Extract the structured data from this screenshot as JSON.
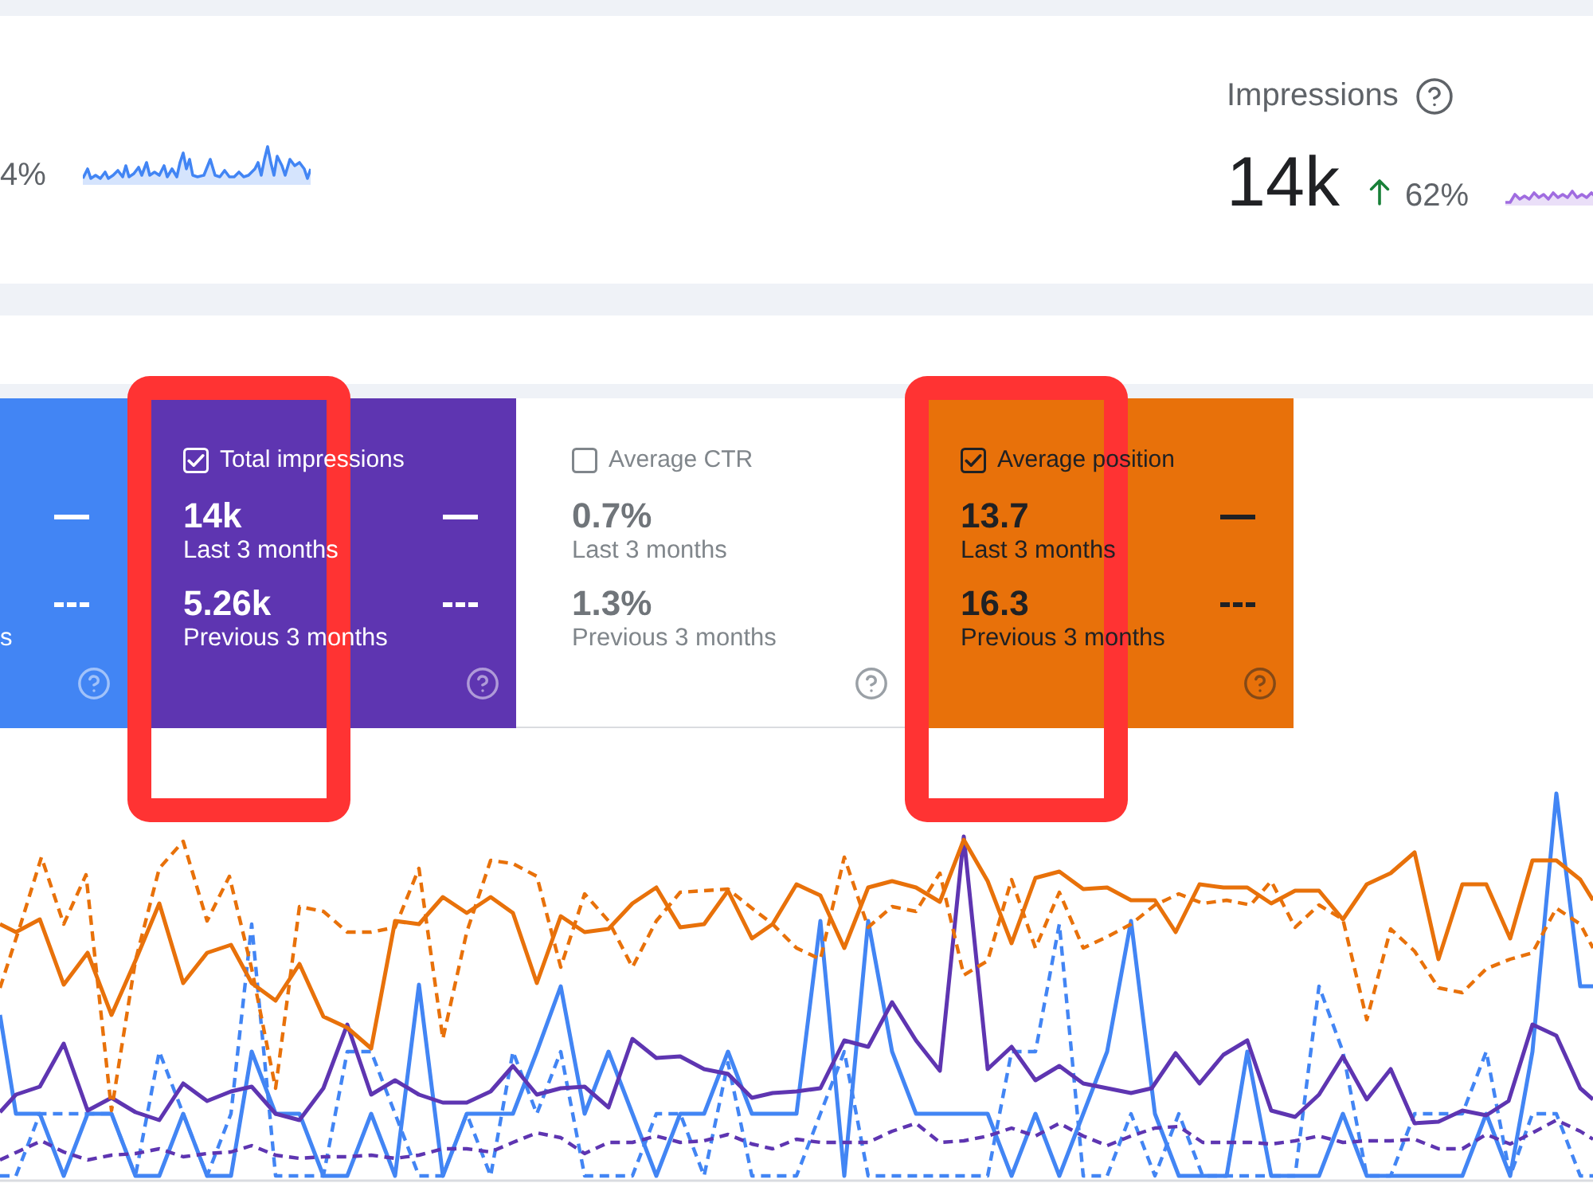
{
  "overview": {
    "metrics": [
      {
        "change": "4%",
        "color": "#4285f4"
      },
      {
        "title": "Impressions",
        "value": "14k",
        "increase": true,
        "change": "62%",
        "color": "#a06ce0"
      }
    ]
  },
  "cards": [
    {
      "checked": true,
      "color": "#4285f4",
      "highlighted": false,
      "previous_label": "s"
    },
    {
      "title": "Total impressions",
      "checked": true,
      "color": "#5e35b1",
      "highlighted": true,
      "value": "14k",
      "value_label": "Last 3 months",
      "previous_value": "5.26k",
      "previous_label": "Previous 3 months"
    },
    {
      "title": "Average CTR",
      "checked": false,
      "highlighted": false,
      "value": "0.7%",
      "value_label": "Last 3 months",
      "previous_value": "1.3%",
      "previous_label": "Previous 3 months"
    },
    {
      "title": "Average position",
      "checked": true,
      "color": "#e8710a",
      "highlighted": true,
      "value": "13.7",
      "value_label": "Last 3 months",
      "previous_value": "16.3",
      "previous_label": "Previous 3 months"
    }
  ]
}
